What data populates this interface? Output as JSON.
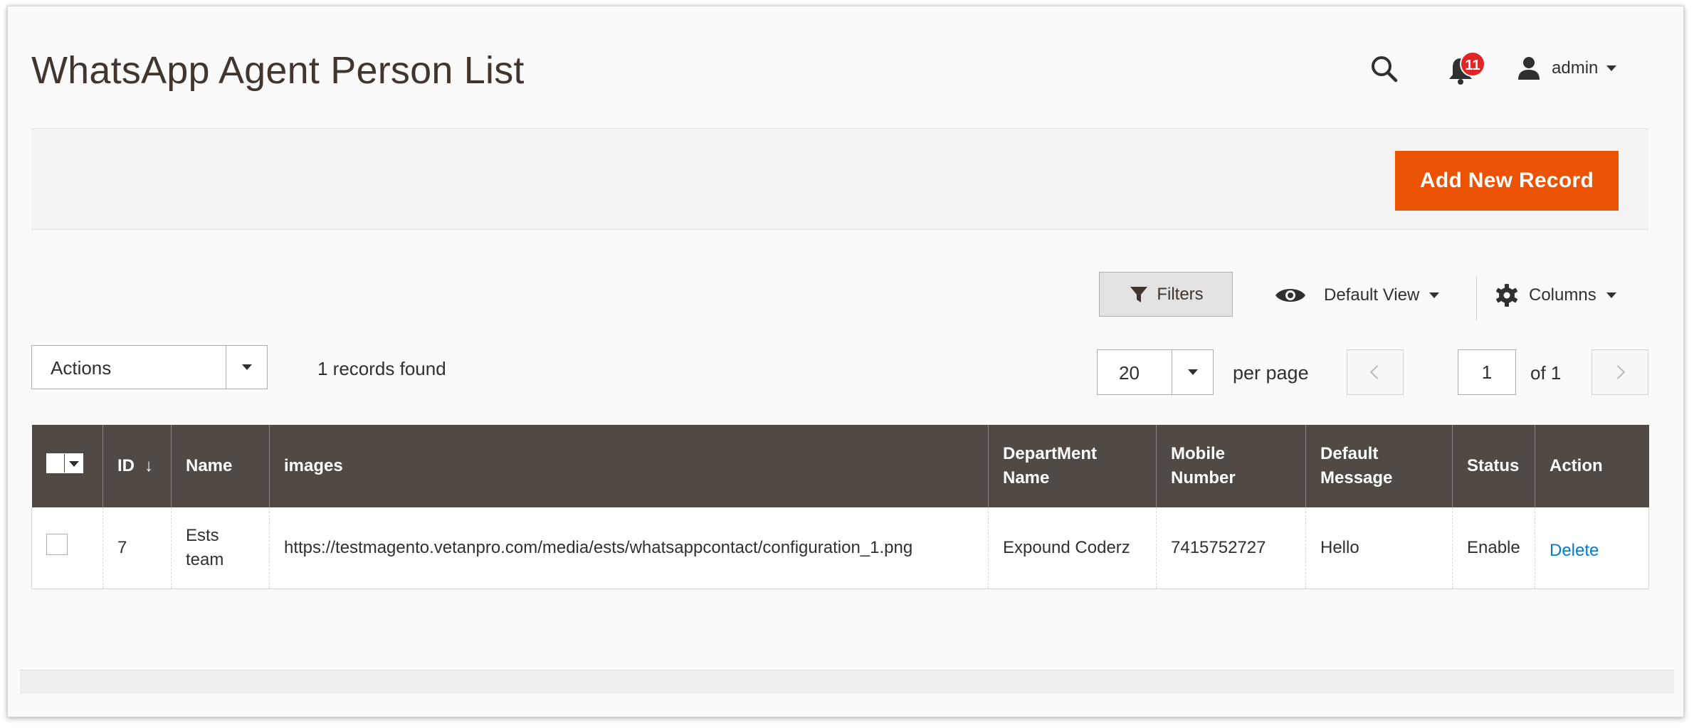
{
  "header": {
    "title": "WhatsApp Agent Person List",
    "search_icon": "search-icon",
    "notifications_count": "11",
    "user_name": "admin"
  },
  "action_bar": {
    "add_button": "Add New Record"
  },
  "toolbar": {
    "filters_label": "Filters",
    "view_label": "Default View",
    "columns_label": "Columns",
    "actions_label": "Actions",
    "records_found": "1 records found",
    "per_page_value": "20",
    "per_page_label": "per page",
    "current_page": "1",
    "page_of": "of 1"
  },
  "colors": {
    "accent": "#eb5202",
    "header_bg": "#514943",
    "notification_badge": "#e22626",
    "link": "#007bdb"
  },
  "table": {
    "columns": [
      {
        "label": "ID"
      },
      {
        "label": "Name"
      },
      {
        "label": "images"
      },
      {
        "label": "DepartMent Name"
      },
      {
        "label": "Mobile Number"
      },
      {
        "label": "Default Message"
      },
      {
        "label": "Status"
      },
      {
        "label": "Action"
      }
    ],
    "sort_arrow": "↓",
    "rows": [
      {
        "id": "7",
        "name": "Ests team",
        "image": "https://testmagento.vetanpro.com/media/ests/whatsappcontact/configuration_1.png",
        "department": "Expound Coderz",
        "mobile": "7415752727",
        "message": "Hello",
        "status": "Enable",
        "action": "Delete"
      }
    ]
  }
}
